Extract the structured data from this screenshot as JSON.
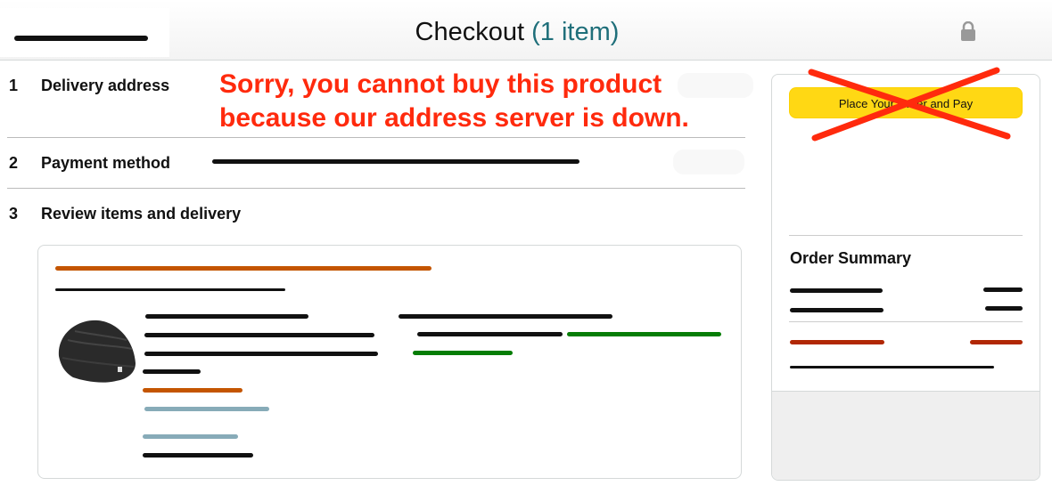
{
  "header": {
    "title": "Checkout",
    "count_open": "(",
    "count": "1 item",
    "count_close": ")",
    "lock_icon": "lock-icon"
  },
  "steps": [
    {
      "number": "1",
      "label": "Delivery address"
    },
    {
      "number": "2",
      "label": "Payment method"
    },
    {
      "number": "3",
      "label": "Review items and delivery"
    }
  ],
  "error": {
    "line1": "Sorry, you cannot buy this product",
    "line2": "because our address server is down.",
    "color": "#ff2a0d"
  },
  "order_panel": {
    "place_order_label": "Place Your Order and Pay",
    "summary_title": "Order Summary"
  },
  "colors": {
    "button": "#ffd814",
    "link": "#1f6f7a",
    "price": "#b12704",
    "in_stock": "#067d06",
    "accent": "#c45500"
  }
}
